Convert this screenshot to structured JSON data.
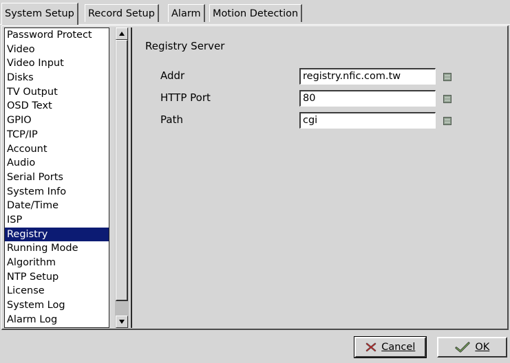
{
  "tabs": [
    {
      "label": "System Setup",
      "active": true
    },
    {
      "label": "Record Setup",
      "active": false
    },
    {
      "label": "Alarm",
      "active": false
    },
    {
      "label": "Motion Detection",
      "active": false
    }
  ],
  "sidebar": {
    "items": [
      "Password Protect",
      "Video",
      "Video Input",
      "Disks",
      "TV Output",
      "OSD Text",
      "GPIO",
      "TCP/IP",
      "Account",
      "Audio",
      "Serial Ports",
      "System Info",
      "Date/Time",
      "ISP",
      "Registry",
      "Running Mode",
      "Algorithm",
      "NTP Setup",
      "License",
      "System Log",
      "Alarm Log"
    ],
    "selected": "Registry"
  },
  "content": {
    "section_title": "Registry Server",
    "fields": [
      {
        "label": "Addr",
        "value": "registry.nfic.com.tw"
      },
      {
        "label": "HTTP Port",
        "value": "80"
      },
      {
        "label": "Path",
        "value": "cgi"
      }
    ]
  },
  "buttons": {
    "cancel_label": "Cancel",
    "ok_label": "OK"
  },
  "icons": {
    "field_button": "keyboard-icon",
    "cancel": "x-icon",
    "ok": "checkmark-icon",
    "scroll_up": "arrow-up-icon",
    "scroll_down": "arrow-down-icon"
  },
  "colors": {
    "selection_bg": "#0c1b73",
    "window_bg": "#d6d6d6"
  }
}
